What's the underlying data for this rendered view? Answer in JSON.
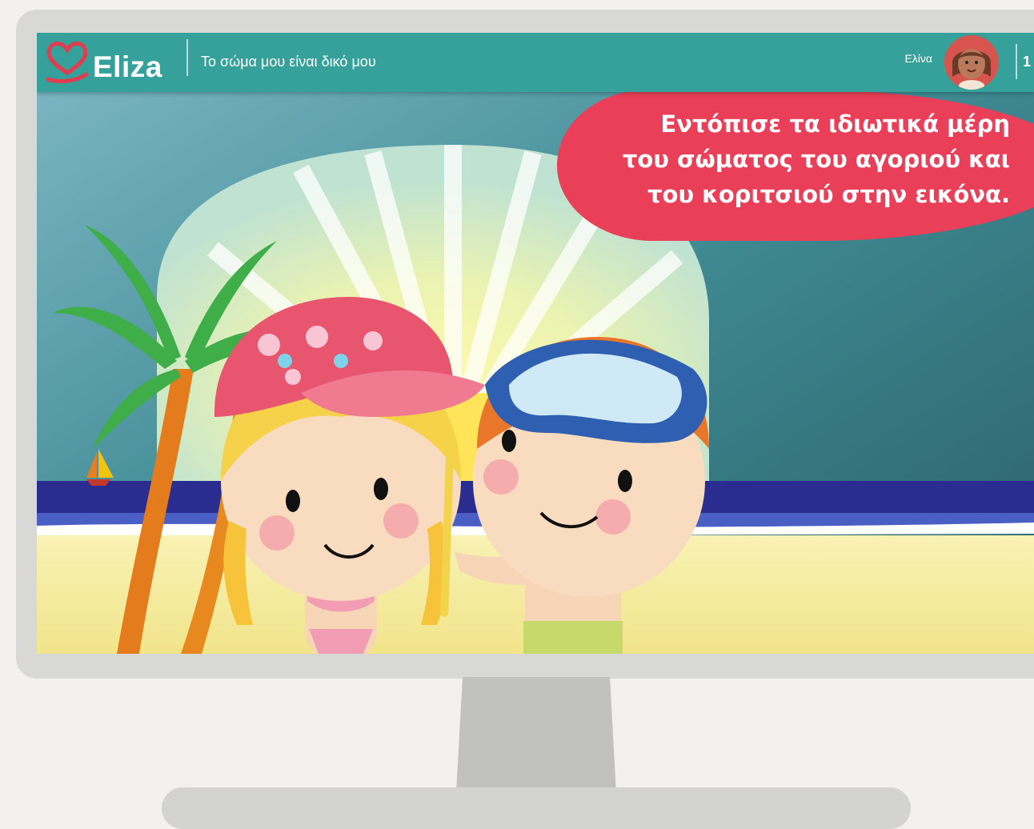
{
  "app": {
    "logo_text": "Eliza",
    "title": "Το σώμα μου είναι δικό μου",
    "user_name": "Ελίνα",
    "score_text": "1"
  },
  "scene": {
    "instruction": "Εντόπισε τα ιδιωτικά μέρη\nτου σώματος του αγοριού και\nτου κοριτσιού στην εικόνα."
  },
  "colors": {
    "topbar": "#35a19a",
    "bubble": "#ea3f58",
    "logo_accent": "#e23c4f"
  }
}
